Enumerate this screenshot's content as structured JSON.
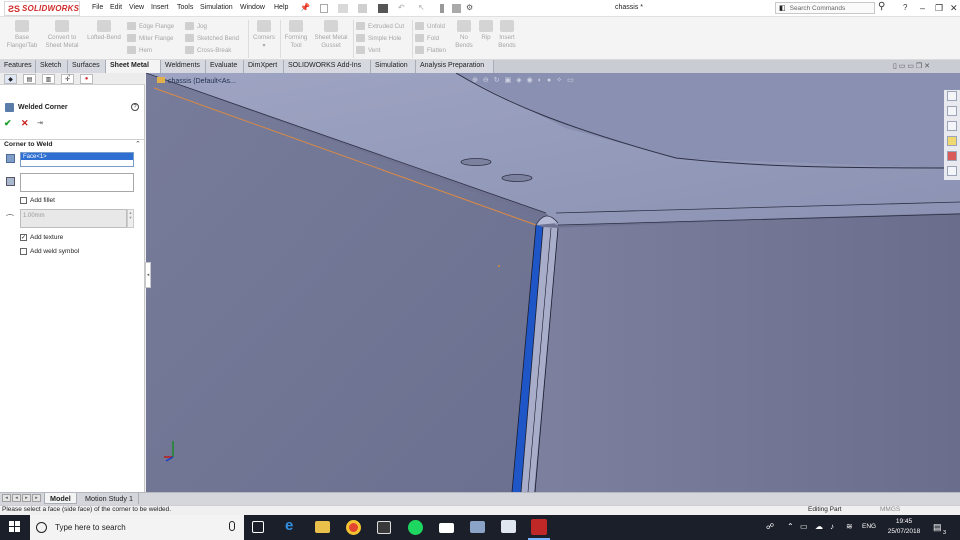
{
  "app": {
    "logo_text": "SOLIDWORKS",
    "document_title": "chassis *",
    "search_placeholder": "Search Commands"
  },
  "menu": [
    "File",
    "Edit",
    "View",
    "Insert",
    "Tools",
    "Simulation",
    "Window",
    "Help"
  ],
  "command_manager": {
    "large_buttons": [
      {
        "label_line1": "Base",
        "label_line2": "Flange/Tab"
      },
      {
        "label_line1": "Convert to",
        "label_line2": "Sheet Metal"
      },
      {
        "label_line1": "Lofted-Bend",
        "label_line2": ""
      },
      {
        "label_line1": "Corners",
        "label_line2": ""
      },
      {
        "label_line1": "Forming",
        "label_line2": "Tool"
      },
      {
        "label_line1": "Sheet Metal",
        "label_line2": "Gusset"
      },
      {
        "label_line1": "No",
        "label_line2": "Bends"
      },
      {
        "label_line1": "Rip",
        "label_line2": ""
      },
      {
        "label_line1": "Insert",
        "label_line2": "Bends"
      }
    ],
    "small_col1": [
      "Edge Flange",
      "Miter Flange",
      "Hem"
    ],
    "small_col2": [
      "Jog",
      "Sketched Bend",
      "Cross-Break"
    ],
    "small_col3": [
      "Extruded Cut",
      "Simple Hole",
      "Vent"
    ],
    "small_col4": [
      "Unfold",
      "Fold",
      "Flatten"
    ]
  },
  "tabs": [
    "Features",
    "Sketch",
    "Surfaces",
    "Sheet Metal",
    "Weldments",
    "Evaluate",
    "DimXpert",
    "SOLIDWORKS Add-Ins",
    "Simulation",
    "Analysis Preparation"
  ],
  "active_tab": "Sheet Metal",
  "property_manager": {
    "title": "Welded Corner",
    "help": "?",
    "ok": "✔",
    "cancel": "✕",
    "pin": "⇥",
    "group_title": "Corner to Weld",
    "selected_face": "Face<1>",
    "add_fillet_label": "Add fillet",
    "add_fillet_checked": false,
    "fillet_value": "1.00mm",
    "add_texture_label": "Add texture",
    "add_texture_checked": true,
    "add_weld_symbol_label": "Add weld symbol",
    "add_weld_symbol_checked": false
  },
  "viewport": {
    "tree_label": "chassis  (Default<As..."
  },
  "bottom_tabs": [
    "Model",
    "Motion Study 1"
  ],
  "status": {
    "message": "Please select a face (side face) of the corner to be welded.",
    "mode": "Editing Part",
    "units": "MMGS"
  },
  "taskbar": {
    "search_text": "Type here to search",
    "language": "ENG",
    "time": "19:45",
    "date": "25/07/2018",
    "notification_count": "3"
  },
  "colors": {
    "viewport_bg": "#6f7391",
    "selected_edge": "#1e56c8",
    "accent_red": "#d12b2b",
    "ok_green": "#1a9e2b"
  }
}
